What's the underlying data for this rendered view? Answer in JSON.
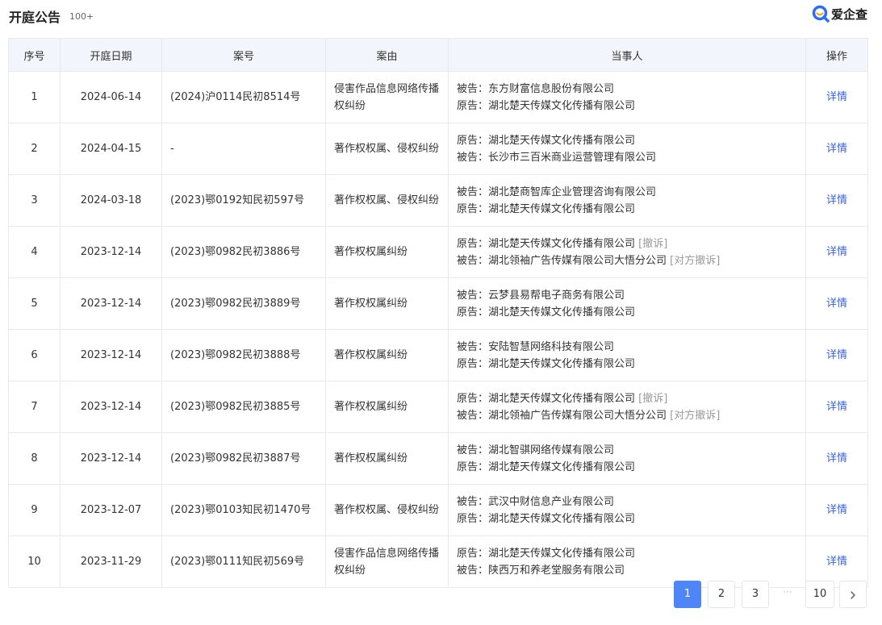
{
  "header": {
    "title": "开庭公告",
    "count": "100+",
    "logo_text": "爱企查"
  },
  "table": {
    "columns": [
      "序号",
      "开庭日期",
      "案号",
      "案由",
      "当事人",
      "操作"
    ],
    "rows": [
      {
        "idx": "1",
        "date": "2024-06-14",
        "case": "(2024)沪0114民初8514号",
        "reason": "侵害作品信息网络传播权纠纷",
        "p1": "被告：东方财富信息股份有限公司",
        "t1": "",
        "p2": "原告：湖北楚天传媒文化传播有限公司",
        "t2": "",
        "action": "详情"
      },
      {
        "idx": "2",
        "date": "2024-04-15",
        "case": "-",
        "reason": "著作权权属、侵权纠纷",
        "p1": "原告：湖北楚天传媒文化传播有限公司",
        "t1": "",
        "p2": "被告：长沙市三百米商业运营管理有限公司",
        "t2": "",
        "action": "详情"
      },
      {
        "idx": "3",
        "date": "2024-03-18",
        "case": "(2023)鄂0192知民初597号",
        "reason": "著作权权属、侵权纠纷",
        "p1": "被告：湖北楚商智库企业管理咨询有限公司",
        "t1": "",
        "p2": "原告：湖北楚天传媒文化传播有限公司",
        "t2": "",
        "action": "详情"
      },
      {
        "idx": "4",
        "date": "2023-12-14",
        "case": "(2023)鄂0982民初3886号",
        "reason": "著作权权属纠纷",
        "p1": "原告：湖北楚天传媒文化传播有限公司",
        "t1": "[撤诉]",
        "p2": "被告：湖北领袖广告传媒有限公司大悟分公司",
        "t2": "[对方撤诉]",
        "action": "详情"
      },
      {
        "idx": "5",
        "date": "2023-12-14",
        "case": "(2023)鄂0982民初3889号",
        "reason": "著作权权属纠纷",
        "p1": "被告：云梦县易帮电子商务有限公司",
        "t1": "",
        "p2": "原告：湖北楚天传媒文化传播有限公司",
        "t2": "",
        "action": "详情"
      },
      {
        "idx": "6",
        "date": "2023-12-14",
        "case": "(2023)鄂0982民初3888号",
        "reason": "著作权权属纠纷",
        "p1": "被告：安陆智慧网络科技有限公司",
        "t1": "",
        "p2": "原告：湖北楚天传媒文化传播有限公司",
        "t2": "",
        "action": "详情"
      },
      {
        "idx": "7",
        "date": "2023-12-14",
        "case": "(2023)鄂0982民初3885号",
        "reason": "著作权权属纠纷",
        "p1": "原告：湖北楚天传媒文化传播有限公司",
        "t1": "[撤诉]",
        "p2": "被告：湖北领袖广告传媒有限公司大悟分公司",
        "t2": "[对方撤诉]",
        "action": "详情"
      },
      {
        "idx": "8",
        "date": "2023-12-14",
        "case": "(2023)鄂0982民初3887号",
        "reason": "著作权权属纠纷",
        "p1": "被告：湖北智骐网络传媒有限公司",
        "t1": "",
        "p2": "原告：湖北楚天传媒文化传播有限公司",
        "t2": "",
        "action": "详情"
      },
      {
        "idx": "9",
        "date": "2023-12-07",
        "case": "(2023)鄂0103知民初1470号",
        "reason": "著作权权属、侵权纠纷",
        "p1": "被告：武汉中财信息产业有限公司",
        "t1": "",
        "p2": "原告：湖北楚天传媒文化传播有限公司",
        "t2": "",
        "action": "详情"
      },
      {
        "idx": "10",
        "date": "2023-11-29",
        "case": "(2023)鄂0111知民初569号",
        "reason": "侵害作品信息网络传播权纠纷",
        "p1": "原告：湖北楚天传媒文化传播有限公司",
        "t1": "",
        "p2": "被告：陕西万和养老堂服务有限公司",
        "t2": "",
        "action": "详情"
      }
    ]
  },
  "pagination": {
    "pages": [
      "1",
      "2",
      "3"
    ],
    "ellipsis": "···",
    "last": "10",
    "current": "1"
  },
  "colors": {
    "accent": "#4e86f7",
    "link": "#3464e0",
    "header_bg": "#f2f6fc",
    "logo_blue": "#2f6cf6",
    "logo_orange": "#f5a623"
  }
}
